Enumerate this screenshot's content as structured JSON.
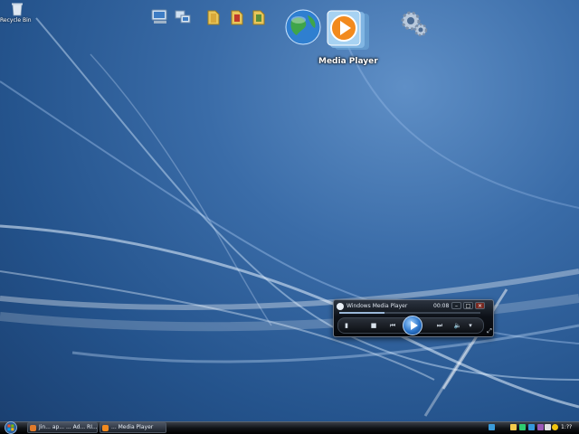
{
  "desktop": {
    "recycle_bin_label": "Recycle Bin"
  },
  "dock": {
    "items": [
      {
        "name": "computer",
        "icon": "computer-icon"
      },
      {
        "name": "network",
        "icon": "network-icon"
      },
      {
        "name": "folder-1",
        "icon": "folder-icon"
      },
      {
        "name": "folder-2",
        "icon": "folder-icon"
      },
      {
        "name": "folder-3",
        "icon": "folder-icon"
      },
      {
        "name": "internet",
        "icon": "globe-icon"
      },
      {
        "name": "media-player",
        "icon": "media-player-icon"
      },
      {
        "name": "settings",
        "icon": "gear-icon"
      }
    ],
    "hover_label": "Media Player"
  },
  "media_player": {
    "title": "Windows Media Player",
    "time": "00:08",
    "progress": 0.32,
    "controls": {
      "minimize": "–",
      "restore": "□",
      "close": "×"
    },
    "buttons": {
      "stop": "■",
      "prev": "⏮",
      "next": "⏭",
      "volume": "🔈"
    }
  },
  "taskbar": {
    "tasks": [
      {
        "label": "Jin... ap... ... Ad... RI..."
      },
      {
        "label": "... Media Player"
      }
    ],
    "clock": "1:??"
  },
  "colors": {
    "wallpaper": "#2e5d98",
    "accent": "#2a73c8"
  }
}
